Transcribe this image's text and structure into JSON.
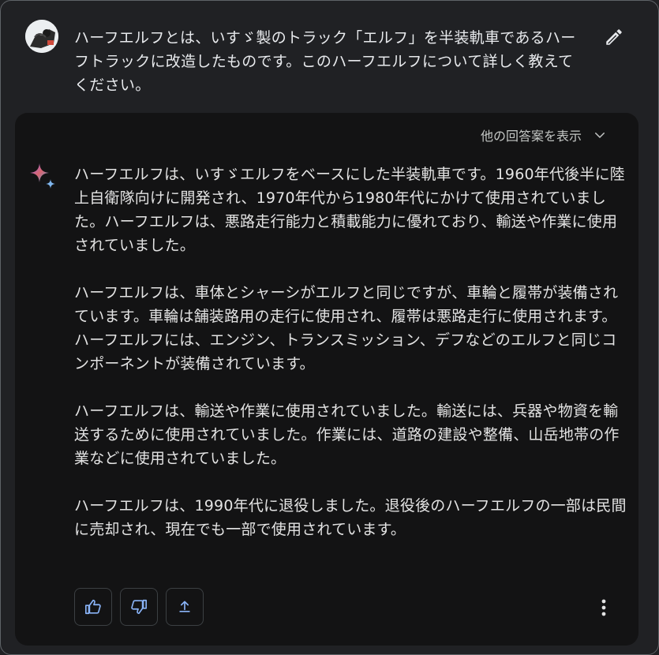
{
  "prompt": {
    "text": "ハーフエルフとは、いすゞ製のトラック「エルフ」を半装軌車であるハーフトラックに改造したものです。このハーフエルフについて詳しく教えてください。",
    "avatar_icon": "user-avatar",
    "edit_icon": "pencil-icon"
  },
  "response": {
    "drafts_label": "他の回答案を表示",
    "paragraphs": [
      "ハーフエルフは、いすゞエルフをベースにした半装軌車です。1960年代後半に陸上自衛隊向けに開発され、1970年代から1980年代にかけて使用されていました。ハーフエルフは、悪路走行能力と積載能力に優れており、輸送や作業に使用されていました。",
      "ハーフエルフは、車体とシャーシがエルフと同じですが、車輪と履帯が装備されています。車輪は舗装路用の走行に使用され、履帯は悪路走行に使用されます。ハーフエルフには、エンジン、トランスミッション、デフなどのエルフと同じコンポーネントが装備されています。",
      "ハーフエルフは、輸送や作業に使用されていました。輸送には、兵器や物資を輸送するために使用されていました。作業には、道路の建設や整備、山岳地帯の作業などに使用されていました。",
      "ハーフエルフは、1990年代に退役しました。退役後のハーフエルフの一部は民間に売却され、現在でも一部で使用されています。"
    ]
  },
  "actions": {
    "icons": [
      "thumbs-up-icon",
      "thumbs-down-icon",
      "share-icon",
      "more-vert-icon"
    ]
  },
  "colors": {
    "page_bg": "#202124",
    "card_bg": "#131314",
    "text": "#e3e3e3",
    "accent_blue": "#8ab4f8"
  }
}
